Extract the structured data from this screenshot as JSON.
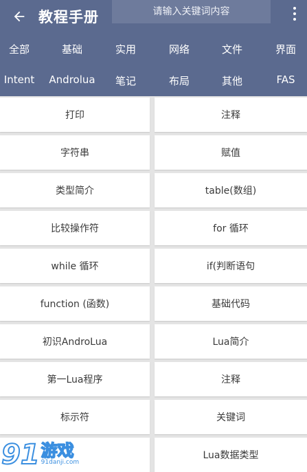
{
  "header": {
    "title": "教程手册",
    "search_placeholder": "请输入关键词内容",
    "back_icon": "arrow-left-icon",
    "more_icon": "more-vert-icon",
    "bar_color": "#5b6a8f"
  },
  "tabs": {
    "row1": [
      "全部",
      "基础",
      "实用",
      "网络",
      "文件",
      "界面"
    ],
    "row2": [
      "Intent",
      "Androlua",
      "笔记",
      "布局",
      "其他",
      "FAS"
    ]
  },
  "items": [
    [
      "打印",
      "注释"
    ],
    [
      "字符串",
      "赋值"
    ],
    [
      "类型简介",
      "table(数组)"
    ],
    [
      "比较操作符",
      "for 循环"
    ],
    [
      "while 循环",
      "if(判断语句"
    ],
    [
      "function (函数)",
      "基础代码"
    ],
    [
      "初识AndroLua",
      "Lua简介"
    ],
    [
      "第一Lua程序",
      "注释"
    ],
    [
      "标示符",
      "关键词"
    ],
    [
      "",
      "Lua数据类型"
    ]
  ],
  "watermark": {
    "number": "91",
    "text": "游戏",
    "url": "91danji.com"
  }
}
